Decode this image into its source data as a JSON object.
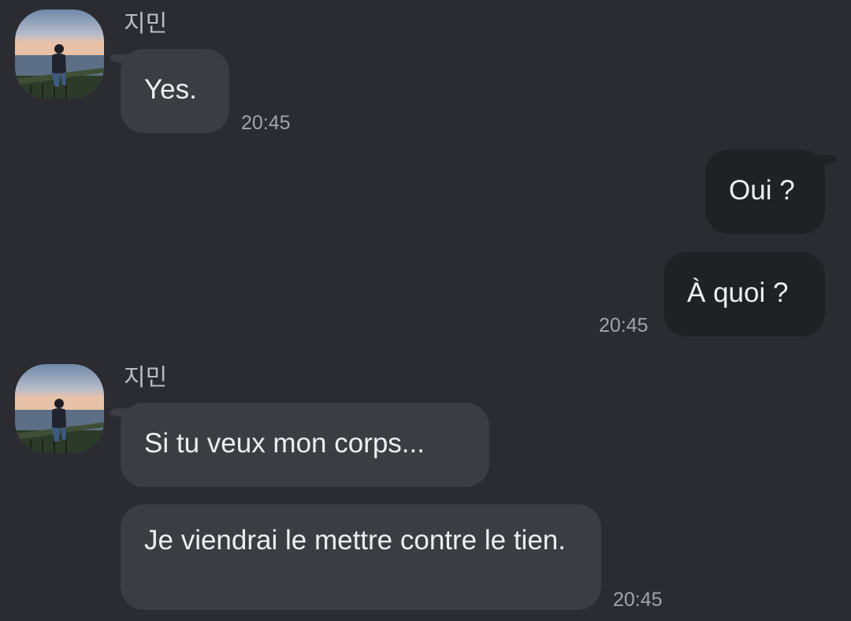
{
  "conversation": {
    "messages": [
      {
        "sender": "지민",
        "text": "Yes.",
        "time": "20:45",
        "direction": "incoming"
      },
      {
        "text": "Oui ?",
        "direction": "outgoing"
      },
      {
        "text": "À quoi ?",
        "time": "20:45",
        "direction": "outgoing"
      },
      {
        "sender": "지민",
        "text": "Si tu veux mon corps...",
        "direction": "incoming"
      },
      {
        "text": "Je viendrai le mettre contre le tien.",
        "time": "20:45",
        "direction": "incoming"
      }
    ]
  },
  "colors": {
    "background": "#2b2c31",
    "incoming_bubble": "#3b3d42",
    "outgoing_bubble": "#202125"
  }
}
